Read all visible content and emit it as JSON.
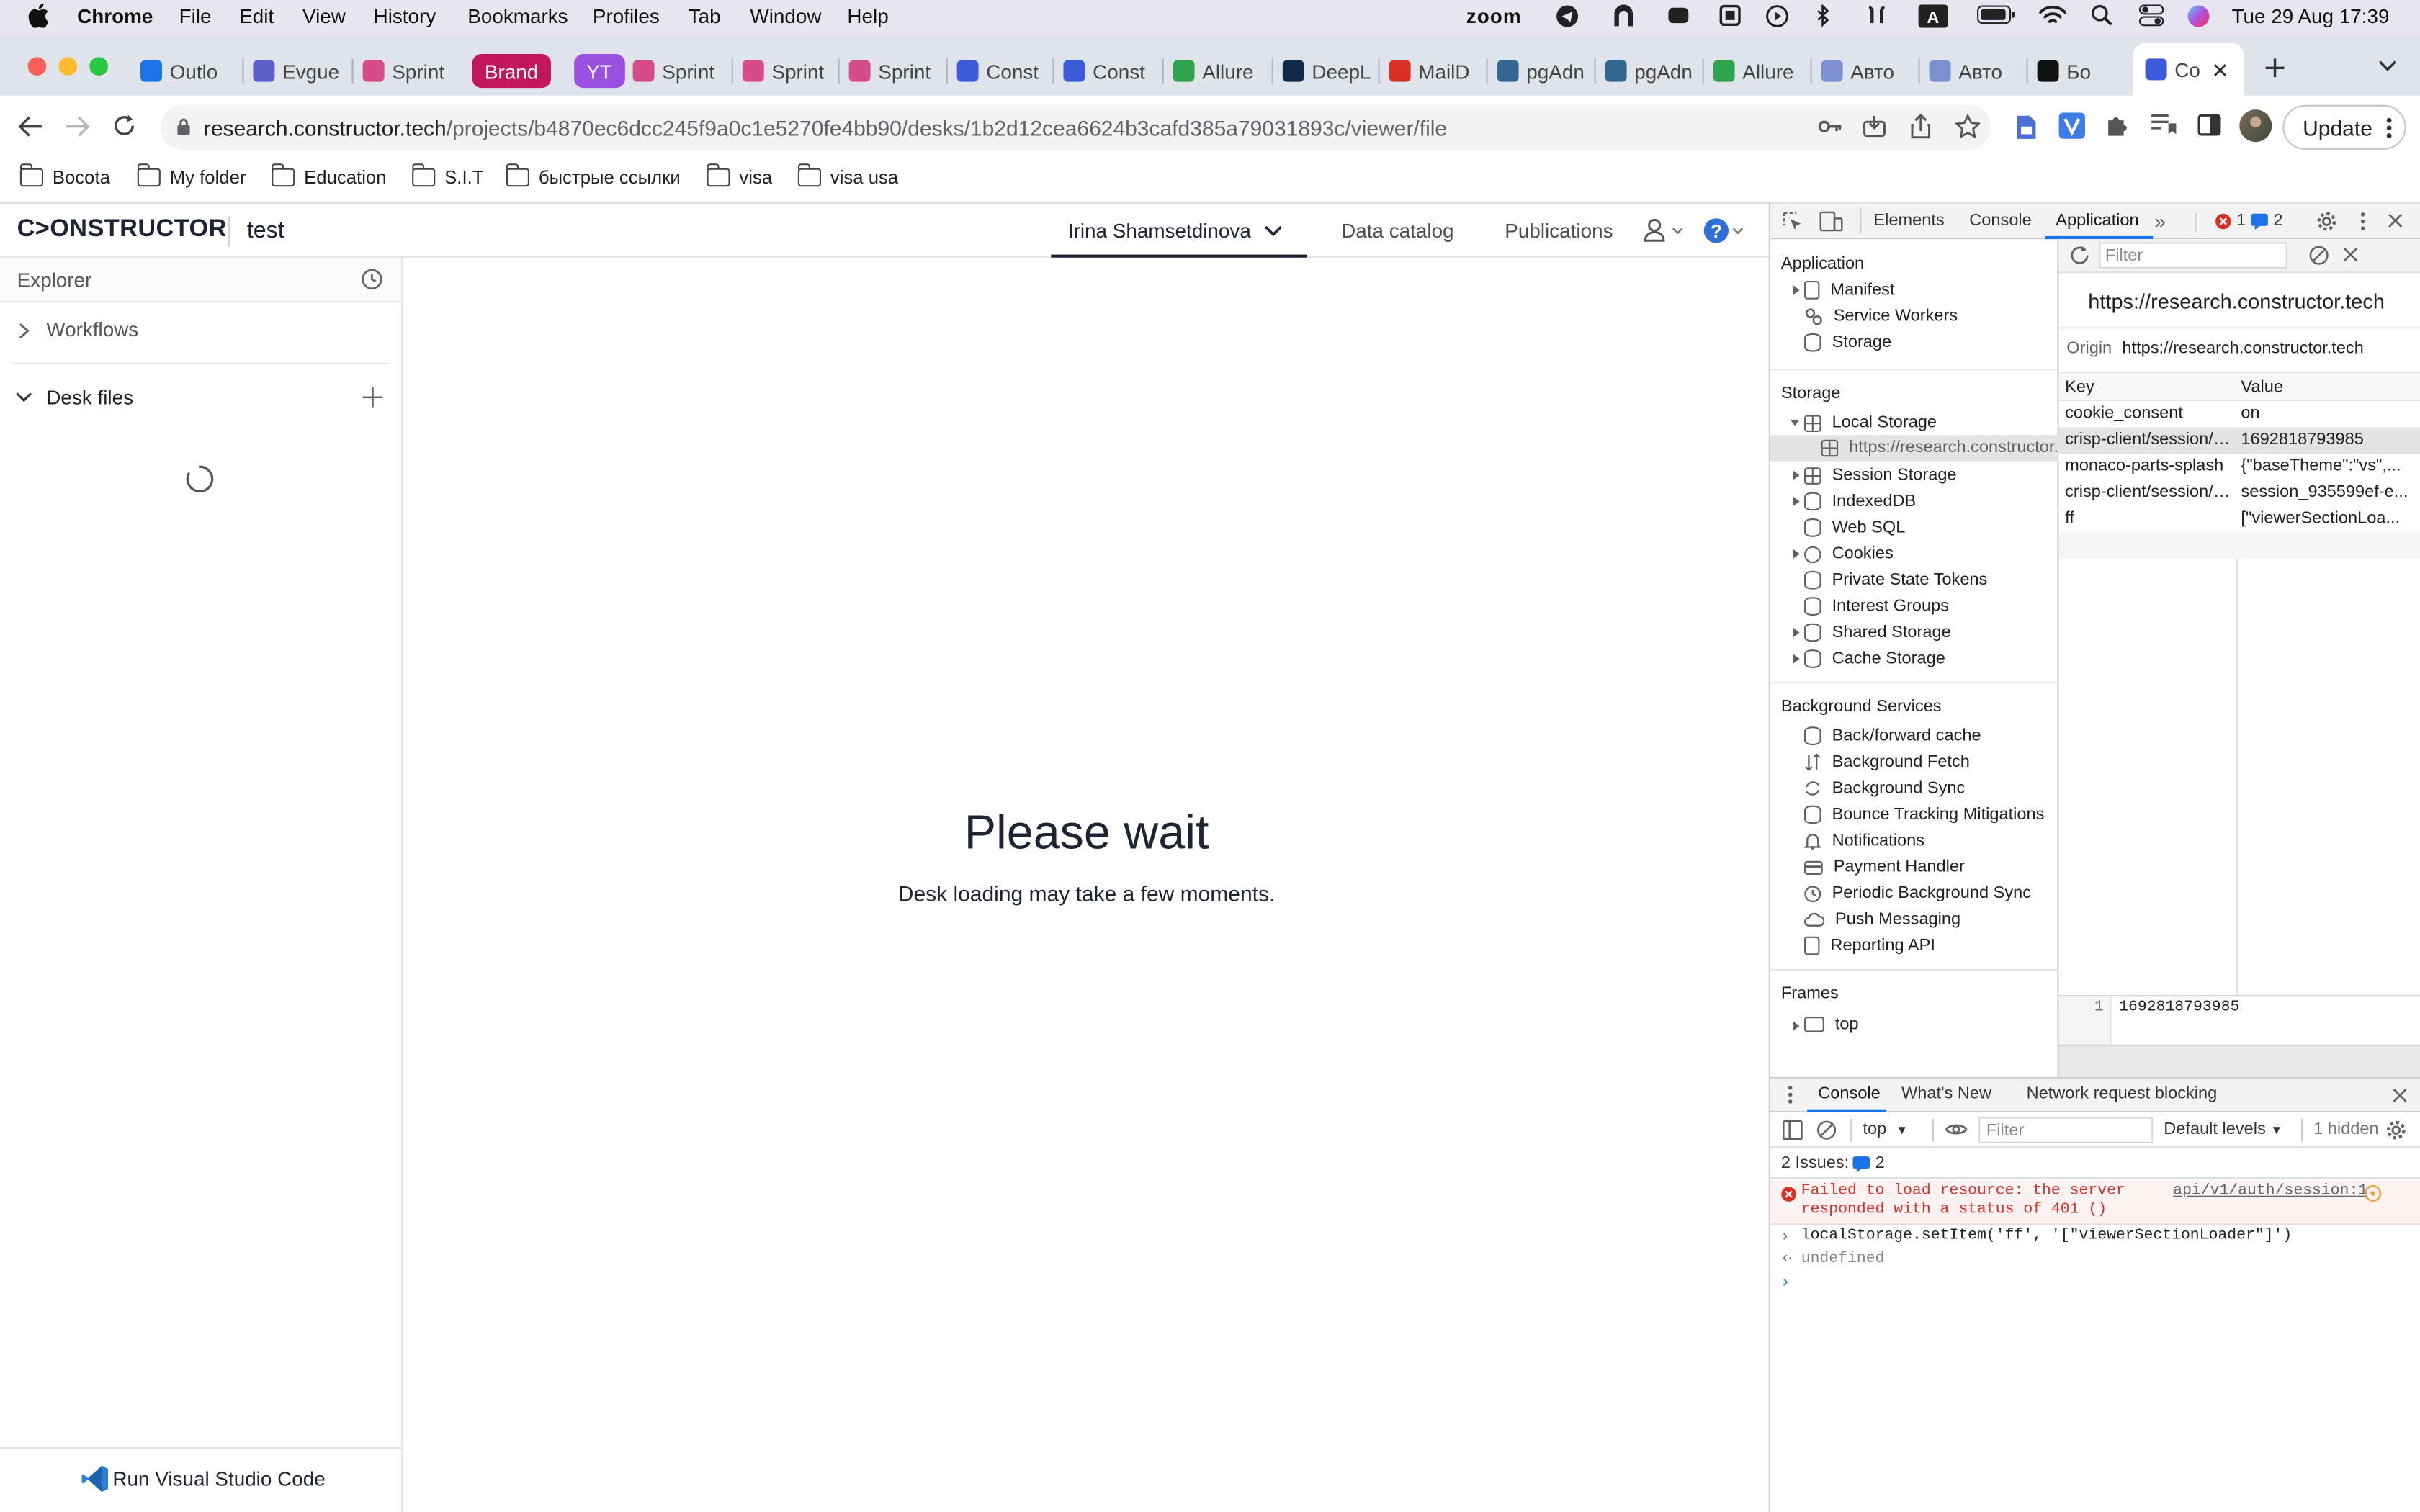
{
  "menubar": {
    "app": "Chrome",
    "items": [
      "File",
      "Edit",
      "View",
      "History",
      "Bookmarks",
      "Profiles",
      "Tab",
      "Window",
      "Help"
    ],
    "zoom_label": "zoom",
    "clock": "Tue 29 Aug  17:39"
  },
  "tabs": [
    {
      "label": "Outlo",
      "color": "#1a73e8"
    },
    {
      "label": "Evgue",
      "color": "#5b5fc7"
    },
    {
      "label": "Sprint",
      "color": "#d64b8a"
    },
    {
      "label": "Brand",
      "color": "#c2185b",
      "pill": true
    },
    {
      "label": "YT",
      "color": "#9b51e0",
      "pill": true
    },
    {
      "label": "Sprint",
      "color": "#d64b8a"
    },
    {
      "label": "Sprint",
      "color": "#d64b8a"
    },
    {
      "label": "Sprint",
      "color": "#d64b8a"
    },
    {
      "label": "Const",
      "color": "#3b5bdb"
    },
    {
      "label": "Const",
      "color": "#3b5bdb"
    },
    {
      "label": "Allure",
      "color": "#2ea44f"
    },
    {
      "label": "DeepL",
      "color": "#0f2b46"
    },
    {
      "label": "MailD",
      "color": "#d93025"
    },
    {
      "label": "pgAdn",
      "color": "#336791"
    },
    {
      "label": "pgAdn",
      "color": "#336791"
    },
    {
      "label": "Allure",
      "color": "#2ea44f"
    },
    {
      "label": "Авто",
      "color": "#7b8fd1"
    },
    {
      "label": "Авто",
      "color": "#7b8fd1"
    },
    {
      "label": "Бо",
      "color": "#111111"
    },
    {
      "label": "Co",
      "color": "#3b5bdb",
      "active": true
    }
  ],
  "toolbar": {
    "url_host": "research.constructor.tech",
    "url_path": "/projects/b4870ec6dcc245f9a0c1e5270fe4bb90/desks/1b2d12cea6624b3cafd385a79031893c/viewer/file",
    "update_label": "Update"
  },
  "bookmarks": [
    "Bocota",
    "My folder",
    "Education",
    "S.I.T",
    "быстрые ссылки",
    "visa",
    "visa usa"
  ],
  "app": {
    "logo": "C>ONSTRUCTOR",
    "project": "test",
    "user": "Irina Shamsetdinova",
    "nav": [
      "Data catalog",
      "Publications"
    ]
  },
  "explorer": {
    "title": "Explorer",
    "workflows": "Workflows",
    "desk_files": "Desk files",
    "run_vscode": "Run Visual Studio Code"
  },
  "main": {
    "heading": "Please wait",
    "sub": "Desk loading may take a few moments."
  },
  "devtools": {
    "tabs": [
      "Elements",
      "Console",
      "Application"
    ],
    "active_tab": "Application",
    "errors": "1",
    "issues": "2",
    "filter_placeholder": "Filter",
    "application_section": "Application",
    "application_items": [
      "Manifest",
      "Service Workers",
      "Storage"
    ],
    "storage_section": "Storage",
    "local_storage": "Local Storage",
    "local_storage_origin": "https://research.constructor.tech",
    "storage_items": [
      "Session Storage",
      "IndexedDB",
      "Web SQL",
      "Cookies",
      "Private State Tokens",
      "Interest Groups",
      "Shared Storage",
      "Cache Storage"
    ],
    "bg_section": "Background Services",
    "bg_items": [
      "Back/forward cache",
      "Background Fetch",
      "Background Sync",
      "Bounce Tracking Mitigations",
      "Notifications",
      "Payment Handler",
      "Periodic Background Sync",
      "Push Messaging",
      "Reporting API"
    ],
    "frames_section": "Frames",
    "frames_top": "top",
    "origin_title": "https://research.constructor.tech",
    "origin_label": "Origin",
    "origin_value": "https://research.constructor.tech",
    "table_key": "Key",
    "table_value": "Value",
    "rows": [
      {
        "key": "cookie_consent",
        "value": "on"
      },
      {
        "key": "crisp-client/session/a...",
        "value": "1692818793985",
        "selected": true
      },
      {
        "key": "monaco-parts-splash",
        "value": "{\"baseTheme\":\"vs\",..."
      },
      {
        "key": "crisp-client/session/a...",
        "value": "session_935599ef-e..."
      },
      {
        "key": "ff",
        "value": "[\"viewerSectionLoa..."
      }
    ],
    "preview_line": "1",
    "preview_value": "1692818793985"
  },
  "console": {
    "tabs": [
      "Console",
      "What's New",
      "Network request blocking"
    ],
    "context": "top",
    "filter_placeholder": "Filter",
    "levels": "Default levels",
    "hidden": "1 hidden",
    "issues_label": "2 Issues:",
    "issues_count": "2",
    "error_line1": "Failed to load resource: the server",
    "error_line2": "responded with a status of 401 ()",
    "error_source": "api/v1/auth/session:1",
    "input": "localStorage.setItem('ff', '[\"viewerSectionLoader\"]')",
    "output": "undefined"
  },
  "colors": {
    "accent": "#1a73e8",
    "error": "#d93025",
    "brand": "#1d2433"
  }
}
